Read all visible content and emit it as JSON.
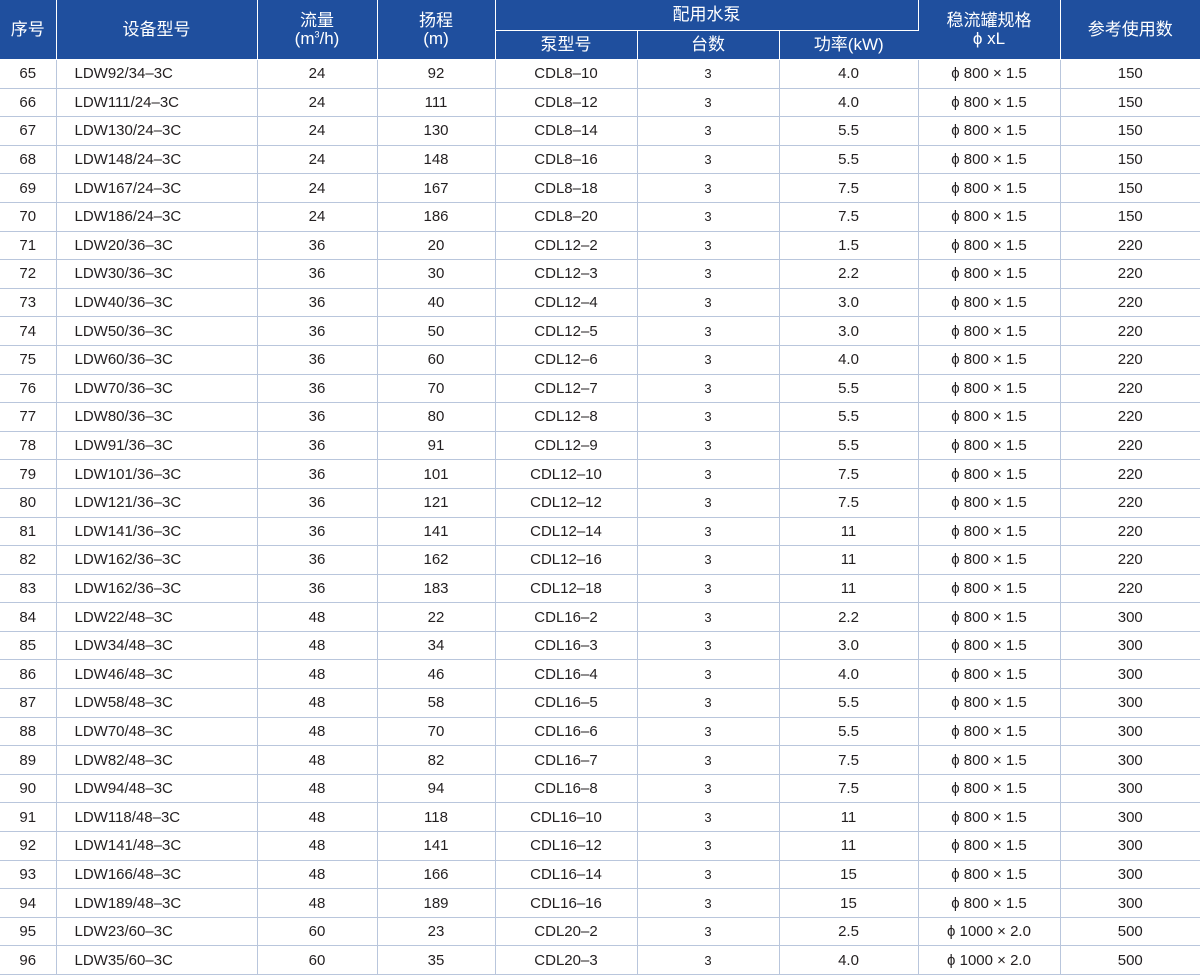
{
  "header": {
    "seq": "序号",
    "model": "设备型号",
    "flow": "流量",
    "flow_unit_pre": "(m",
    "flow_unit_sup": "3",
    "flow_unit_post": "/h)",
    "head": "扬程",
    "head_unit": "(m)",
    "pump_group": "配用水泵",
    "pump_model": "泵型号",
    "pump_units": "台数",
    "pump_power": "功率(kW)",
    "tank_spec": "稳流罐规格",
    "tank_spec_sub": "ϕ xL",
    "ref_users": "参考使用数"
  },
  "rows": [
    [
      "65",
      "LDW92/34–3C",
      "24",
      "92",
      "CDL8–10",
      "3",
      "4.0",
      "ϕ 800 × 1.5",
      "150"
    ],
    [
      "66",
      "LDW111/24–3C",
      "24",
      "111",
      "CDL8–12",
      "3",
      "4.0",
      "ϕ 800 × 1.5",
      "150"
    ],
    [
      "67",
      "LDW130/24–3C",
      "24",
      "130",
      "CDL8–14",
      "3",
      "5.5",
      "ϕ 800 × 1.5",
      "150"
    ],
    [
      "68",
      "LDW148/24–3C",
      "24",
      "148",
      "CDL8–16",
      "3",
      "5.5",
      "ϕ 800 × 1.5",
      "150"
    ],
    [
      "69",
      "LDW167/24–3C",
      "24",
      "167",
      "CDL8–18",
      "3",
      "7.5",
      "ϕ 800 × 1.5",
      "150"
    ],
    [
      "70",
      "LDW186/24–3C",
      "24",
      "186",
      "CDL8–20",
      "3",
      "7.5",
      "ϕ 800 × 1.5",
      "150"
    ],
    [
      "71",
      "LDW20/36–3C",
      "36",
      "20",
      "CDL12–2",
      "3",
      "1.5",
      "ϕ 800 × 1.5",
      "220"
    ],
    [
      "72",
      "LDW30/36–3C",
      "36",
      "30",
      "CDL12–3",
      "3",
      "2.2",
      "ϕ 800 × 1.5",
      "220"
    ],
    [
      "73",
      "LDW40/36–3C",
      "36",
      "40",
      "CDL12–4",
      "3",
      "3.0",
      "ϕ 800 × 1.5",
      "220"
    ],
    [
      "74",
      "LDW50/36–3C",
      "36",
      "50",
      "CDL12–5",
      "3",
      "3.0",
      "ϕ 800 × 1.5",
      "220"
    ],
    [
      "75",
      "LDW60/36–3C",
      "36",
      "60",
      "CDL12–6",
      "3",
      "4.0",
      "ϕ 800 × 1.5",
      "220"
    ],
    [
      "76",
      "LDW70/36–3C",
      "36",
      "70",
      "CDL12–7",
      "3",
      "5.5",
      "ϕ 800 × 1.5",
      "220"
    ],
    [
      "77",
      "LDW80/36–3C",
      "36",
      "80",
      "CDL12–8",
      "3",
      "5.5",
      "ϕ 800 × 1.5",
      "220"
    ],
    [
      "78",
      "LDW91/36–3C",
      "36",
      "91",
      "CDL12–9",
      "3",
      "5.5",
      "ϕ 800 × 1.5",
      "220"
    ],
    [
      "79",
      "LDW101/36–3C",
      "36",
      "101",
      "CDL12–10",
      "3",
      "7.5",
      "ϕ 800 × 1.5",
      "220"
    ],
    [
      "80",
      "LDW121/36–3C",
      "36",
      "121",
      "CDL12–12",
      "3",
      "7.5",
      "ϕ 800 × 1.5",
      "220"
    ],
    [
      "81",
      "LDW141/36–3C",
      "36",
      "141",
      "CDL12–14",
      "3",
      "11",
      "ϕ 800 × 1.5",
      "220"
    ],
    [
      "82",
      "LDW162/36–3C",
      "36",
      "162",
      "CDL12–16",
      "3",
      "11",
      "ϕ 800 × 1.5",
      "220"
    ],
    [
      "83",
      "LDW162/36–3C",
      "36",
      "183",
      "CDL12–18",
      "3",
      "11",
      "ϕ 800 × 1.5",
      "220"
    ],
    [
      "84",
      "LDW22/48–3C",
      "48",
      "22",
      "CDL16–2",
      "3",
      "2.2",
      "ϕ 800 × 1.5",
      "300"
    ],
    [
      "85",
      "LDW34/48–3C",
      "48",
      "34",
      "CDL16–3",
      "3",
      "3.0",
      "ϕ 800 × 1.5",
      "300"
    ],
    [
      "86",
      "LDW46/48–3C",
      "48",
      "46",
      "CDL16–4",
      "3",
      "4.0",
      "ϕ 800 × 1.5",
      "300"
    ],
    [
      "87",
      "LDW58/48–3C",
      "48",
      "58",
      "CDL16–5",
      "3",
      "5.5",
      "ϕ 800 × 1.5",
      "300"
    ],
    [
      "88",
      "LDW70/48–3C",
      "48",
      "70",
      "CDL16–6",
      "3",
      "5.5",
      "ϕ 800 × 1.5",
      "300"
    ],
    [
      "89",
      "LDW82/48–3C",
      "48",
      "82",
      "CDL16–7",
      "3",
      "7.5",
      "ϕ 800 × 1.5",
      "300"
    ],
    [
      "90",
      "LDW94/48–3C",
      "48",
      "94",
      "CDL16–8",
      "3",
      "7.5",
      "ϕ 800 × 1.5",
      "300"
    ],
    [
      "91",
      "LDW118/48–3C",
      "48",
      "118",
      "CDL16–10",
      "3",
      "11",
      "ϕ 800 × 1.5",
      "300"
    ],
    [
      "92",
      "LDW141/48–3C",
      "48",
      "141",
      "CDL16–12",
      "3",
      "11",
      "ϕ 800 × 1.5",
      "300"
    ],
    [
      "93",
      "LDW166/48–3C",
      "48",
      "166",
      "CDL16–14",
      "3",
      "15",
      "ϕ 800 × 1.5",
      "300"
    ],
    [
      "94",
      "LDW189/48–3C",
      "48",
      "189",
      "CDL16–16",
      "3",
      "15",
      "ϕ 800 × 1.5",
      "300"
    ],
    [
      "95",
      "LDW23/60–3C",
      "60",
      "23",
      "CDL20–2",
      "3",
      "2.5",
      "ϕ 1000 × 2.0",
      "500"
    ],
    [
      "96",
      "LDW35/60–3C",
      "60",
      "35",
      "CDL20–3",
      "3",
      "4.0",
      "ϕ 1000 × 2.0",
      "500"
    ]
  ]
}
